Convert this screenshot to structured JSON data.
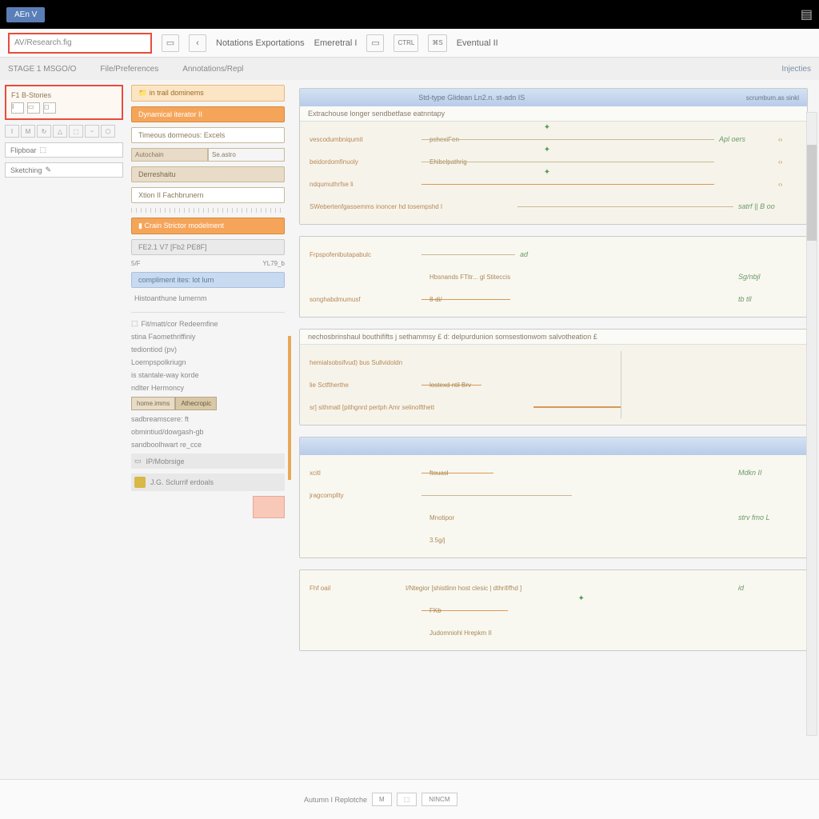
{
  "titlebar": {
    "tab": "AEn V"
  },
  "toolbar": {
    "search_placeholder": "AV/Research.fig",
    "links": [
      "Notations Exportations",
      "Emeretral I",
      "Eventual II"
    ],
    "pill_a": "CTRL",
    "pill_b": "⌘S"
  },
  "subheader": {
    "left": "STAGE 1 MSGO/O",
    "mids": [
      "File/Preferences",
      "Annotations/Repl"
    ],
    "right": "Injecties"
  },
  "leftcol": {
    "card_title": "F1 B-Stories",
    "btns": [
      "Flipboar",
      "Sketching"
    ],
    "icons": [
      "I",
      "M",
      "↻",
      "△",
      "⬚",
      "~",
      "⬡"
    ]
  },
  "midcol": {
    "folder": "in trail dominems",
    "items": [
      "Dynamical iterator II",
      "Timeous dormeous: Excels",
      "Autochain",
      "Derreshaitu",
      "Xtion II  Fachbrunern"
    ],
    "orange_cta": "Crain Strictor modelment",
    "nums": "FE2.1 V7  [Fb2  PE8F]",
    "stat_l": "5/F",
    "stat_r": "YL79_b",
    "blue_btn": "compliment ites: lot lurn",
    "caption": "Histoanthune lumernm",
    "lower_header": "Fit/matt/cor Redeemfine",
    "lower_items": [
      "stina Faomethriffiniy",
      "tediontiod (pv)",
      "Loempspolkriugn",
      "is stantale-way korde",
      "ndlter Hermoncy"
    ],
    "dual": [
      "home.imms",
      "Athecropic"
    ],
    "tail": [
      "sadbreamscere: ft",
      "obmintiud/dowgash-gb",
      "sandboolhwart re_cce"
    ],
    "foot_a": "IP/Mobrsige",
    "foot_b": "J.G. Sclurrif erdoals"
  },
  "content": {
    "tab_label": "Injecties",
    "panels": [
      {
        "hd_center": "Std-type Glidean Ln2.n. st-adn IS",
        "hd_right": "scrumbum.as sinkl",
        "sub": "Extrachouse longer sendbetfase  eatnntapy",
        "rows": [
          {
            "l": "vescodumbniqumit",
            "m": "pchexiFen",
            "r": "Apl oers"
          },
          {
            "l": "beidordomfinuoly",
            "m": "Ehibelpathrig",
            "r": ""
          },
          {
            "l": "ndqumuthrfse li",
            "m": "",
            "r": ""
          },
          {
            "l": "SWebertenfgassemms inoncer hd tosempshd I",
            "m": "",
            "r": "satrf || B oo"
          }
        ]
      },
      {
        "rows": [
          {
            "l": "Frpspofenibutapabulc",
            "m": "",
            "r": "ad"
          },
          {
            "l": "",
            "m": "Hbsnands   FTitr...   gl Stiteccis",
            "r": "Sg/nbjl"
          },
          {
            "l": "songhabdmumusf",
            "m": "8-di/",
            "r": "tb tll"
          }
        ]
      },
      {
        "sub": "nechosbrinshaul  bouthififts j  sethammsy £  d:  delpurdunion  somsestionwom  salvotheation £",
        "rows": [
          {
            "l": "hemialsobsifvud) bus  Sullvidoldn",
            "m": "",
            "r": ""
          },
          {
            "l": "lie Sctftherthe",
            "m": "lostexd ntil Brv",
            "r": ""
          },
          {
            "l": "sr] sithmatl  [pithgnrd pertph Amr  selinolfthett",
            "m": "",
            "r": ""
          }
        ]
      },
      {
        "hd": " ",
        "rows": [
          {
            "l": "xcitl",
            "m": "ftouasl",
            "r": "Mdkn II"
          },
          {
            "l": "jragcompllty",
            "m": "",
            "r": ""
          },
          {
            "l": "",
            "m": "Mnotipor",
            "r": "strv fmo L"
          },
          {
            "l": "",
            "m": "3.5g/j",
            "r": ""
          }
        ]
      },
      {
        "rows": [
          {
            "l": "Fhf oail",
            "m": "I/Ntegior [shistlinn  host clesic | dthrif/fhd ]",
            "r": "id"
          },
          {
            "l": "",
            "m": "FKb",
            "r": ""
          },
          {
            "l": "",
            "m": "Judomniohl   Hrepkm II",
            "r": ""
          }
        ]
      }
    ]
  },
  "bottom": {
    "label": "Autumn I Replotche",
    "btns": [
      "M",
      "⬚",
      "NINCM"
    ]
  }
}
